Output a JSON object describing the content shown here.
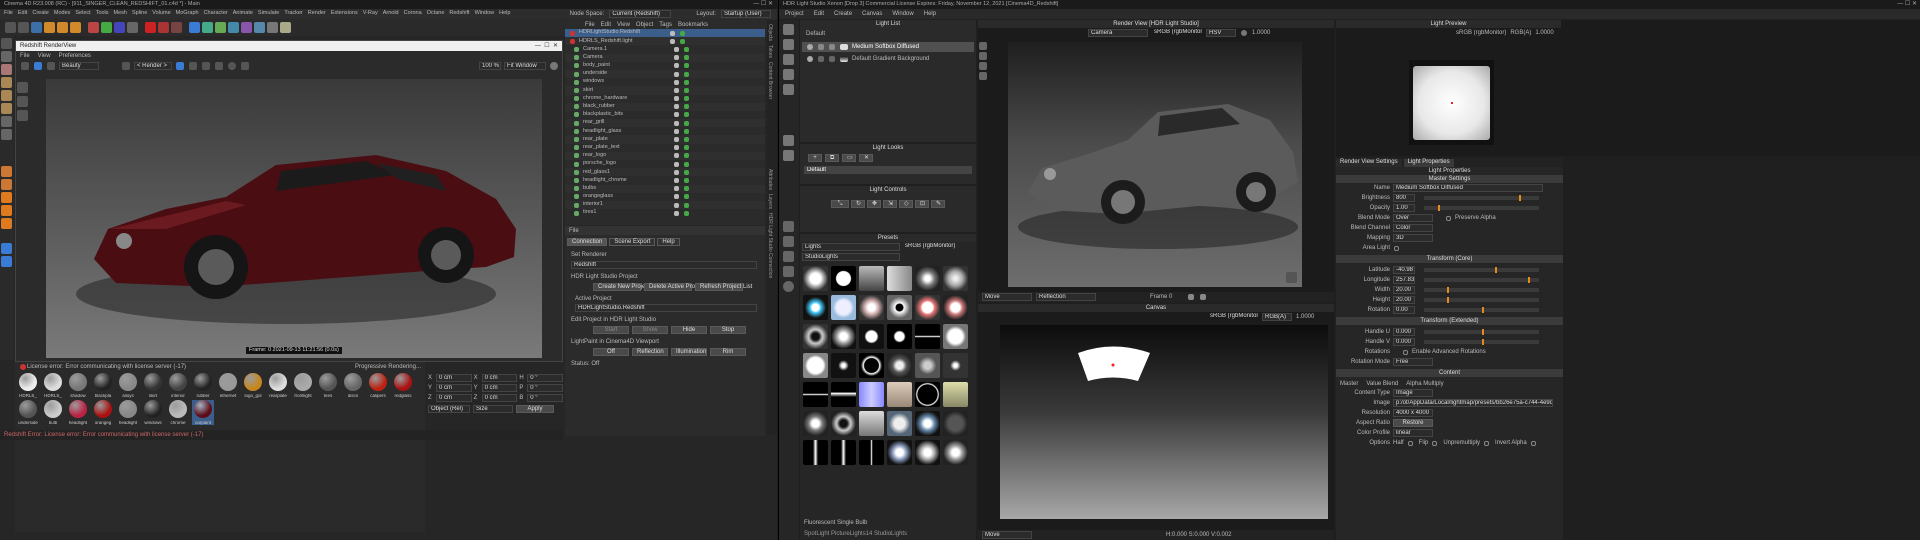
{
  "c4d": {
    "title": "Cinema 4D R23.008 (RC) - [911_SINGER_CLEAN_REDSHIFT_01.c4d *] - Main",
    "menu": [
      "File",
      "Edit",
      "Create",
      "Modes",
      "Select",
      "Tools",
      "Mesh",
      "Spline",
      "Volume",
      "MoGraph",
      "Character",
      "Animate",
      "Simulate",
      "Tracker",
      "Render",
      "Extensions",
      "V-Ray",
      "Arnold",
      "Corona",
      "Octane",
      "Redshift",
      "Window",
      "Help"
    ],
    "node_space_label": "Node Space:",
    "node_space_value": "Current (Redshift)",
    "layout_label": "Layout:",
    "layout_value": "Startup (User)",
    "rv": {
      "title": "Redshift RenderView",
      "menu": [
        "File",
        "View",
        "Preferences"
      ],
      "beauty": "Beauty",
      "render_sel": "< Render >",
      "zoom": "100 %",
      "fit": "Fit Window",
      "frame_info": "Frame: 0   2021-09-13  11:21:56  (0.0s)",
      "status": "License error: Error communicating with license server (-17)",
      "progressive": "Progressive Rendering..."
    },
    "om": {
      "menu": [
        "File",
        "Edit",
        "View",
        "Object",
        "Tags",
        "Bookmarks"
      ],
      "items": [
        "HDRLightStudio.Redshift",
        "HDRLS_Redshift.light",
        "Camera.1",
        "Camera",
        "body_paint",
        "underside",
        "windows",
        "skirt",
        "chrome_hardware",
        "black_rubber",
        "blackplastic_bits",
        "rear_grill",
        "headlight_glass",
        "rear_plate",
        "rear_plate_text",
        "rear_logo",
        "porsche_logo",
        "red_glass1",
        "headlight_chrome",
        "bulbs",
        "orangeglass",
        "interior1",
        "tires1"
      ]
    },
    "attr": {
      "file_label": "File",
      "tabs": [
        "Connection",
        "Scene Export",
        "Help"
      ],
      "set_renderer": "Set Renderer",
      "renderer": "Redshift",
      "project_title": "HDR Light Studio Project",
      "btn_new": "Create New Project",
      "btn_delete": "Delete Active Project",
      "btn_refresh": "Refresh Project List",
      "active_project_label": "Active Project",
      "active_project": "HDRLightStudio.Redshift",
      "edit_project": "Edit Project in HDR Light Studio",
      "btn_start": "Start",
      "btn_show": "Show",
      "btn_hide": "Hide",
      "btn_stop": "Stop",
      "lightpaint": "LightPaint in Cinema4D Viewport",
      "btn_off": "Off",
      "btn_reflection": "Reflection",
      "btn_illumination": "Illumination",
      "btn_rim": "Rim",
      "status": "Status: Off"
    },
    "mat": {
      "names": [
        "HDRLS_",
        "HDRLS_",
        "shadow",
        "blackpla",
        "alloys",
        "skirt",
        "interior",
        "rubber",
        "ethernet",
        "logo_gol",
        "rearplate",
        "frontlight",
        "tires",
        "discs",
        "calipers",
        "redglass",
        "underside",
        "bulb",
        "headlight",
        "orangeg",
        "headlight",
        "windows",
        "chrome",
        "carpaint"
      ]
    },
    "coords": {
      "rows": [
        [
          "X",
          "0 cm",
          "X",
          "0 cm",
          "H",
          "0 °"
        ],
        [
          "Y",
          "0 cm",
          "Y",
          "0 cm",
          "P",
          "0 °"
        ],
        [
          "Z",
          "0 cm",
          "Z",
          "0 cm",
          "B",
          "0 °"
        ]
      ],
      "obj_rel": "Object (Rel)",
      "size": "Size",
      "apply": "Apply"
    },
    "status_bar": "Redshift Error: License error: Error communicating with license server (-17)",
    "side_tabs": [
      "Objects",
      "Takes",
      "Content Browser",
      "Layers",
      "Structure"
    ],
    "side_tabs2": [
      "Attributes",
      "Layers",
      "Structure",
      "HDR Light Studio Connection"
    ]
  },
  "hdr": {
    "title": "HDR Light Studio Xenon [Drop 3] Commercial License Expires: Friday, November 12, 2021 [Cinema4D_Redshift]",
    "menu": [
      "Project",
      "Edit",
      "Create",
      "Canvas",
      "Window",
      "Help"
    ],
    "light_list": {
      "title": "Light List",
      "default": "Default",
      "items": [
        "Medium Softbox Diffused",
        "Default Gradient Background"
      ]
    },
    "light_looks": {
      "title": "Light Looks",
      "default": "Default"
    },
    "light_controls": {
      "title": "Light Controls"
    },
    "presets": {
      "title": "Presets",
      "dropdown": "Lights",
      "sub": "StudioLights",
      "colorspace": "sRGB (rgbMonitor)",
      "caption": "Fluorescent Single Bulb",
      "footer": "SpotLight PictureLights14 StudioLights"
    },
    "render_view": {
      "title": "Render View [HDR Light Studio]",
      "camera": "Camera",
      "cs": "sRGB (rgbMonitor)",
      "hsv": "HSV",
      "val": "1.0000",
      "move": "Move",
      "reflection": "Reflection",
      "frame": "Frame 0"
    },
    "canvas": {
      "title": "Canvas",
      "cs": "sRGB (rgbMonitor)",
      "rgba": "RGB(A)",
      "val": "1.0000",
      "move": "Move",
      "coords": "H:0.000 S:0.000 V:0.002"
    },
    "light_preview": {
      "title": "Light Preview",
      "cs": "sRGB (rgbMonitor)",
      "rgba": "RGB(A)",
      "val": "1.0000"
    },
    "props": {
      "tabs": [
        "Render View Settings",
        "Light Properties"
      ],
      "title": "Light Properties",
      "master": "Master Settings",
      "name_label": "Name",
      "name": "Medium Softbox Diffused",
      "brightness_label": "Brightness",
      "brightness": "800",
      "opacity_label": "Opacity",
      "opacity": "1.00",
      "blend_label": "Blend Mode",
      "blend": "Over",
      "preserve": "Preserve Alpha",
      "blendch_label": "Blend Channel",
      "blendch": "Color",
      "mapping_label": "Mapping",
      "mapping": "3D",
      "area_light": "Area Light",
      "transform_core": "Transform (Core)",
      "lat_label": "Latitude",
      "lat": "-40.98",
      "lon_label": "Longitude",
      "lon": "257.83",
      "width_label": "Width",
      "width": "20.00",
      "height_label": "Height",
      "height": "20.00",
      "rot_label": "Rotation",
      "rot": "0.00",
      "transform_ext": "Transform (Extended)",
      "hu_label": "Handle U",
      "hu": "0.000",
      "hv_label": "Handle V",
      "hv": "0.000",
      "rotations_label": "Rotations",
      "adv_rot": "Enable Advanced Rotations",
      "rot_mode_label": "Rotation Mode",
      "rot_mode": "Free",
      "content": "Content",
      "ctabs": [
        "Master",
        "Value Blend",
        "Alpha Multiply"
      ],
      "ctype_label": "Content Type",
      "ctype": "Image",
      "image_label": "Image",
      "image": "p:/ot/AppData/Local/lightmap/presets/bb26e75a-c744-4e9d-82c2-1a1a4b77284a.tx",
      "res_label": "Resolution",
      "res": "4000 x 4000",
      "aspect_label": "Aspect Ratio",
      "restore": "Restore",
      "cprofile_label": "Color Profile",
      "cprofile": "linear",
      "options_label": "Options",
      "opts": [
        "Half",
        "Flip",
        "Unpremultiply",
        "Invert Alpha"
      ]
    }
  }
}
